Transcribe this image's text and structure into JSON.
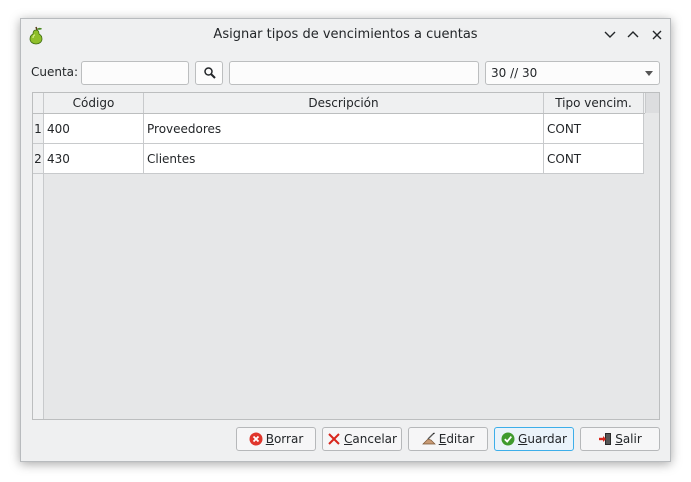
{
  "window": {
    "title": "Asignar tipos de vencimientos a cuentas"
  },
  "filter": {
    "cuenta_label": "Cuenta:",
    "cuenta_value": "",
    "description_value": "",
    "combo_value": "30 // 30"
  },
  "table": {
    "columns": [
      "Código",
      "Descripción",
      "Tipo vencim."
    ],
    "rows": [
      {
        "num": "1",
        "codigo": "400",
        "descripcion": "Proveedores",
        "tipo": "CONT"
      },
      {
        "num": "2",
        "codigo": "430",
        "descripcion": "Clientes",
        "tipo": "CONT"
      }
    ]
  },
  "buttons": {
    "borrar": {
      "first": "B",
      "rest": "orrar"
    },
    "cancelar": {
      "first": "C",
      "rest": "ancelar"
    },
    "editar": {
      "first": "E",
      "rest": "ditar"
    },
    "guardar": {
      "first": "G",
      "rest": "uardar"
    },
    "salir": {
      "first": "S",
      "rest": "alir"
    }
  },
  "colors": {
    "accent": "#3daee9",
    "window_bg": "#eff0f1"
  }
}
